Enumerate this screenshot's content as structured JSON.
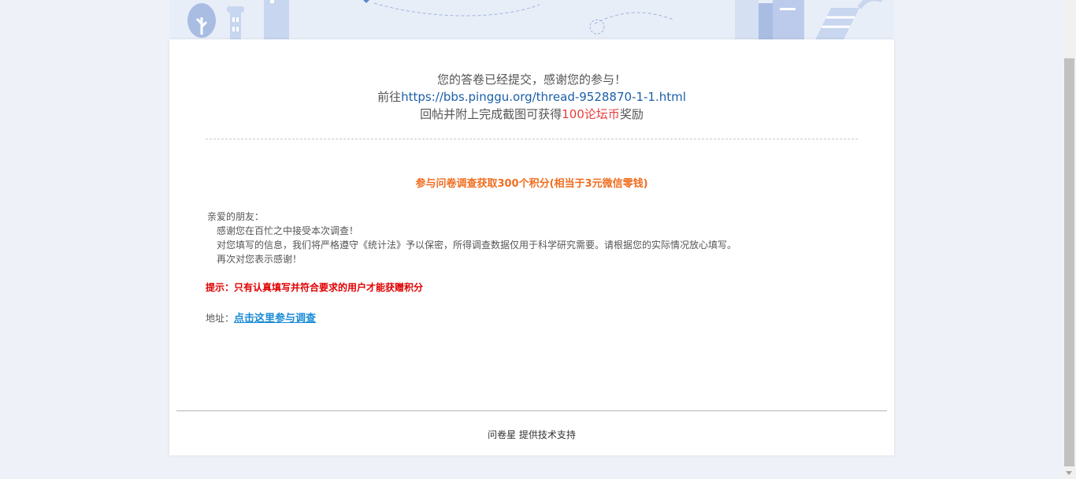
{
  "message": {
    "line1": "您的答卷已经提交，感谢您的参与！",
    "line2_prefix": "前往",
    "line2_link": "https://bbs.pinggu.org/thread-9528870-1-1.html",
    "line3_prefix": "回帖并附上完成截图可获得",
    "line3_highlight": "100论坛币",
    "line3_suffix": "奖励"
  },
  "survey": {
    "heading": "参与问卷调查获取300个积分(相当于3元微信零钱)",
    "greeting": "亲爱的朋友：",
    "body": [
      "感谢您在百忙之中接受本次调查！",
      "对您填写的信息，我们将严格遵守《统计法》予以保密，所得调查数据仅用于科学研究需要。请根据您的实际情况放心填写。",
      "再次对您表示感谢！"
    ],
    "tip": "提示：只有认真填写并符合要求的用户才能获赠积分",
    "address_label": "地址：",
    "address_link": "点击这里参与调查"
  },
  "footer": {
    "brand": "问卷星",
    "text": "提供技术支持"
  },
  "colors": {
    "link": "#1b5fa8",
    "highlight": "#e83c3c",
    "heading": "#f06d1f",
    "tip": "#e00000",
    "survey_link": "#1a8bd6"
  }
}
